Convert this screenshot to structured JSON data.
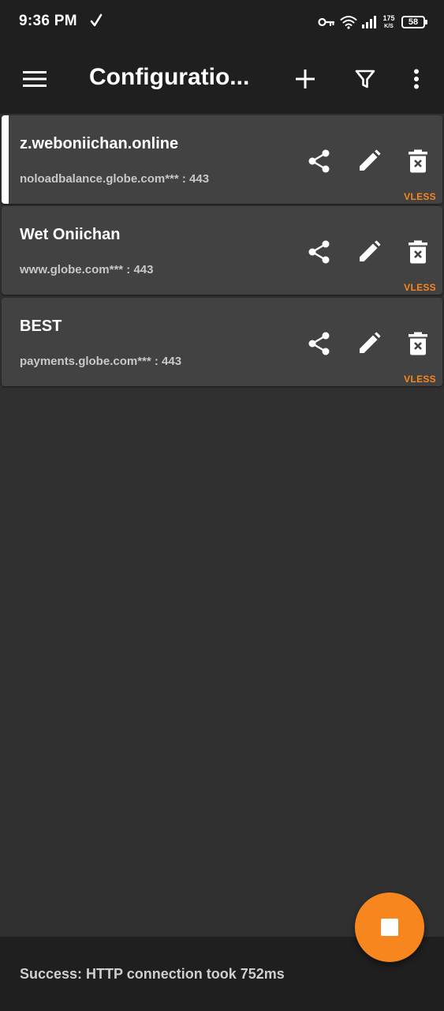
{
  "status_bar": {
    "time": "9:36 PM",
    "net_speed_value": "175",
    "net_speed_unit": "K/S",
    "battery": "58",
    "icons": [
      "check-icon",
      "vpn-key-icon",
      "wifi-icon",
      "signal-icon"
    ]
  },
  "toolbar": {
    "title": "Configuratio...",
    "icons": [
      "menu-icon",
      "add-icon",
      "filter-icon",
      "more-vert-icon"
    ]
  },
  "configs": [
    {
      "name": "z.weboniichan.online",
      "address": "noloadbalance.globe.com*** : 443",
      "type": "VLESS",
      "selected": true
    },
    {
      "name": "Wet Oniichan",
      "address": "www.globe.com*** : 443",
      "type": "VLESS",
      "selected": false
    },
    {
      "name": "BEST",
      "address": "payments.globe.com*** : 443",
      "type": "VLESS",
      "selected": false
    }
  ],
  "card_actions": [
    "share-icon",
    "edit-icon",
    "delete-icon"
  ],
  "fab": {
    "icon": "stop-icon",
    "color": "#f7861f"
  },
  "bottom_status": {
    "text": "Success: HTTP connection took 752ms"
  },
  "colors": {
    "background": "#303030",
    "toolbar": "#1f1f1f",
    "card": "#424242",
    "accent": "#f7861f"
  }
}
